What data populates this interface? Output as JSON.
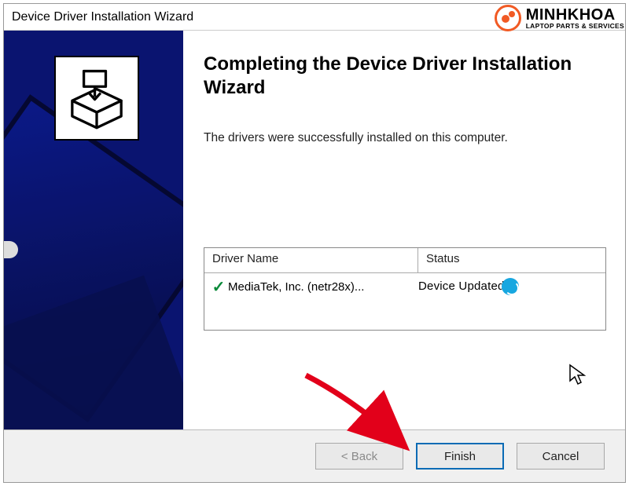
{
  "window": {
    "title": "Device Driver Installation Wizard"
  },
  "main": {
    "heading": "Completing the Device Driver Installation Wizard",
    "body_text": "The drivers were successfully installed on this computer."
  },
  "table": {
    "col_name": "Driver Name",
    "col_status": "Status",
    "rows": [
      {
        "name": "MediaTek, Inc. (netr28x)...",
        "status": "Device Updated"
      }
    ]
  },
  "buttons": {
    "back": "< Back",
    "finish": "Finish",
    "cancel": "Cancel"
  },
  "watermark": {
    "name": "MINHKHOA",
    "tagline": "LAPTOP PARTS & SERVICES"
  },
  "icons": {
    "install": "install-box-icon",
    "check": "checkmark-icon",
    "spinner": "progress-spinner-icon",
    "cursor": "mouse-cursor-icon",
    "arrow": "red-arrow-annotation"
  },
  "colors": {
    "sidebar_bg": "#0a1470",
    "primary_border": "#0a6bb5",
    "check_green": "#0a8a3a",
    "spinner_blue": "#17a7e0",
    "arrow_red": "#e2001a",
    "brand_orange": "#f15a24"
  }
}
